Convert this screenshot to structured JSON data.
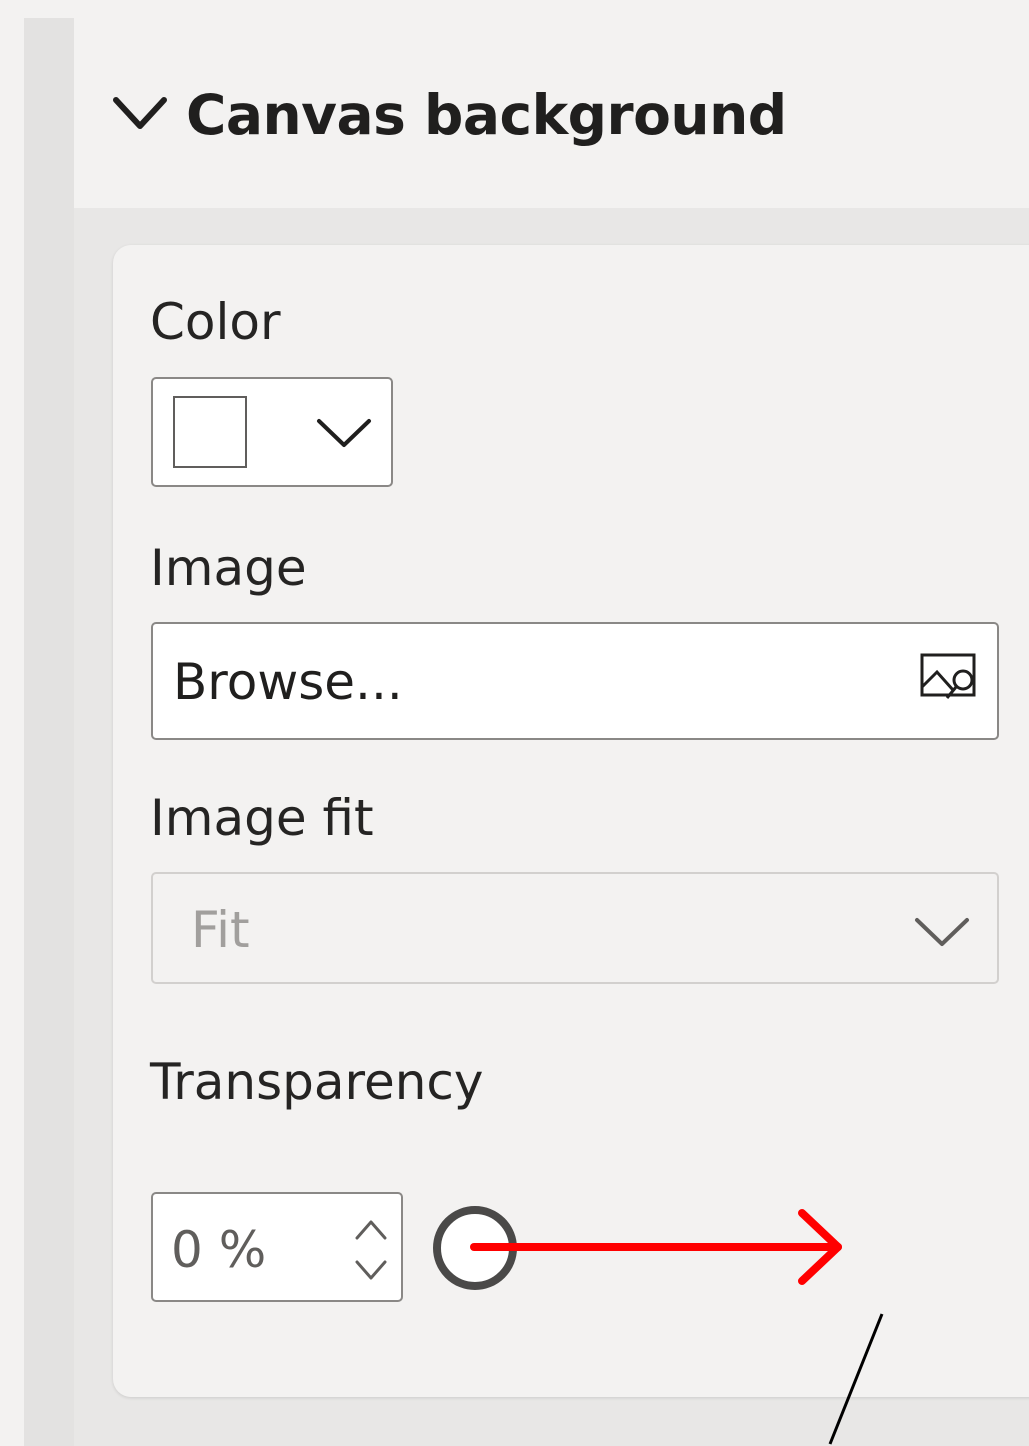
{
  "section": {
    "title": "Canvas background",
    "expanded": true
  },
  "fields": {
    "color": {
      "label": "Color",
      "swatch_color": "#ffffff"
    },
    "image": {
      "label": "Image",
      "value": "Browse...",
      "icon": "image-search-icon"
    },
    "image_fit": {
      "label": "Image fit",
      "value": "Fit",
      "disabled": true
    },
    "transparency": {
      "label": "Transparency",
      "value": "0 %",
      "slider_value_percent": 0
    }
  },
  "annotation": {
    "arrow_color": "#ff0000",
    "line_color": "#000000"
  },
  "colors": {
    "panel_bg": "#f3f2f1",
    "border": "#8a8886",
    "text": "#252423",
    "disabled_text": "#a19f9d"
  }
}
